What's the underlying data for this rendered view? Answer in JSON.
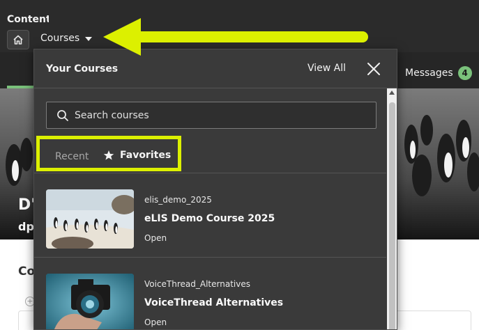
{
  "topbar": {
    "home_icon": "home-icon",
    "courses_label": "Courses"
  },
  "subnav": {
    "content_tab": "Content",
    "messages_label": "Messages",
    "messages_count": "4"
  },
  "banner": {
    "title": "D'",
    "code": "dp_"
  },
  "page": {
    "heading": "Co"
  },
  "panel": {
    "title": "Your Courses",
    "view_all": "View All",
    "search_placeholder": "Search courses",
    "tabs": {
      "recent": "Recent",
      "favorites": "Favorites"
    },
    "courses": [
      {
        "code": "elis_demo_2025",
        "name": "eLIS Demo Course 2025",
        "status": "Open",
        "thumbnail": "penguins-on-beach"
      },
      {
        "code": "VoiceThread_Alternatives",
        "name": "VoiceThread Alternatives",
        "status": "Open",
        "thumbnail": "hand-holding-camera"
      }
    ]
  },
  "colors": {
    "accent_green": "#7ac17b",
    "annotation_yellow": "#dcf000",
    "panel_bg": "#3a3a3a"
  }
}
